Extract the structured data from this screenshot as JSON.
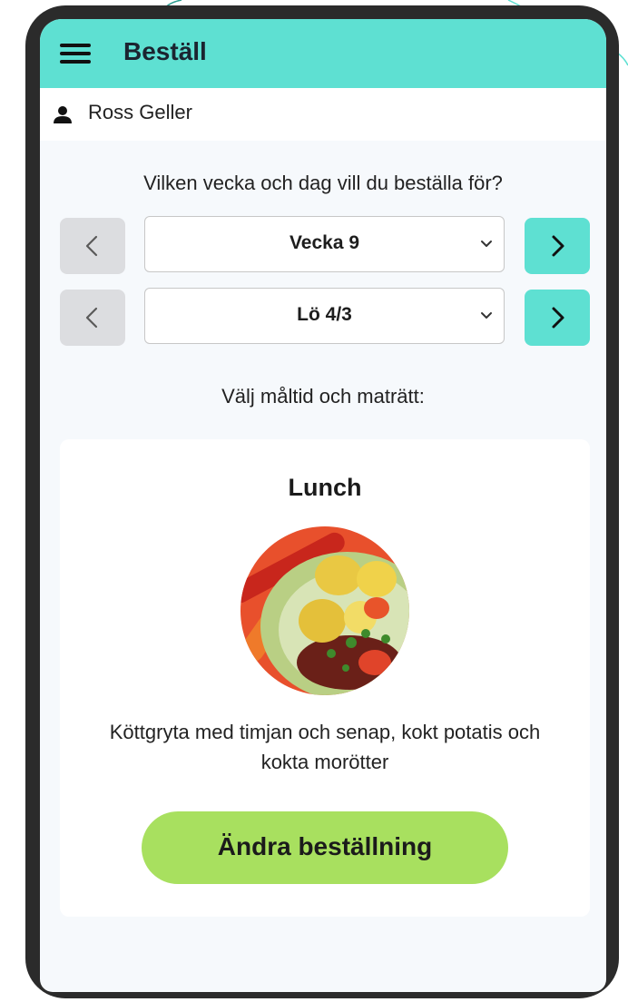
{
  "app": {
    "title": "Beställ",
    "accent_color": "#5ee0d2",
    "menu_icon": "menu-icon"
  },
  "user": {
    "name": "Ross Geller",
    "icon": "user-icon"
  },
  "order": {
    "question": "Vilken vecka och dag vill du beställa för?",
    "week": {
      "value": "Vecka 9"
    },
    "day": {
      "value": "Lö 4/3"
    },
    "meal_prompt": "Välj måltid och maträtt:"
  },
  "meal_card": {
    "title": "Lunch",
    "description": "Köttgryta med timjan och senap, kokt potatis och kokta morötter",
    "button_label": "Ändra beställning",
    "button_color": "#a8e05f"
  }
}
